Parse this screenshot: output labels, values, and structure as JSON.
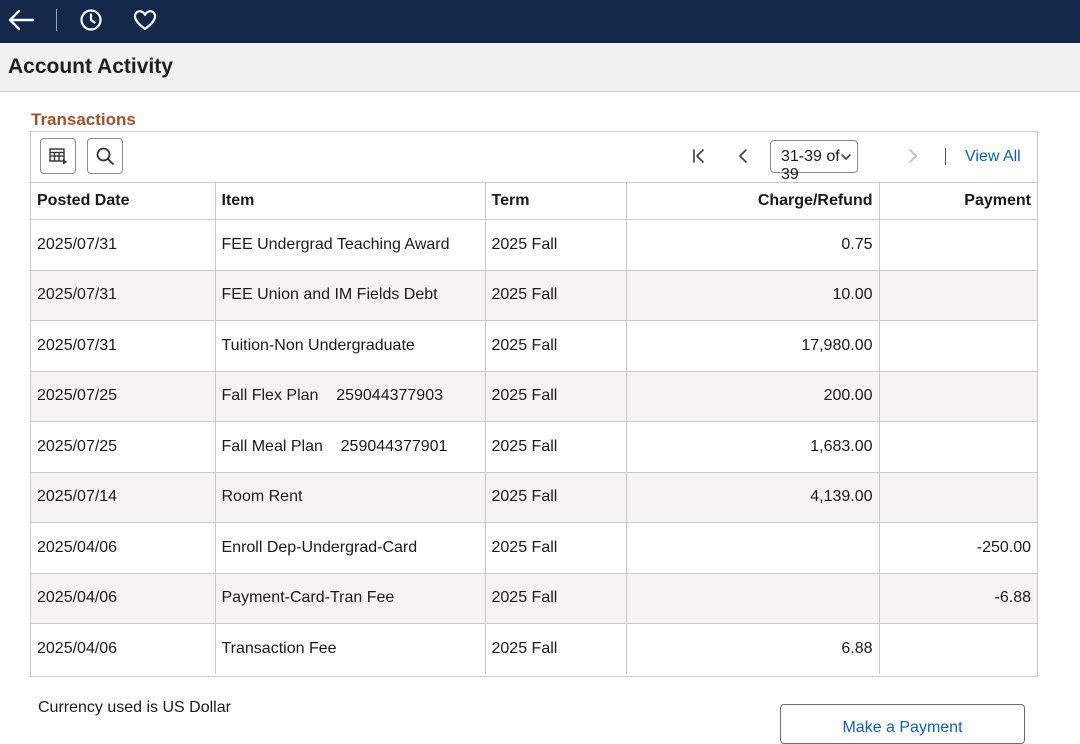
{
  "topbar": {
    "icons": [
      "back-arrow-icon",
      "history-icon",
      "favorite-heart-icon"
    ],
    "background": "#13284b"
  },
  "page": {
    "title": "Account Activity"
  },
  "transactions": {
    "section_title": "Transactions",
    "toolbar": {
      "grid_options_icon": "grid-options-icon",
      "search_icon": "search-icon"
    },
    "pager": {
      "range_label": "31-39 of 39",
      "view_all": "View All"
    },
    "columns": [
      "Posted Date",
      "Item",
      "Term",
      "Charge/Refund",
      "Payment"
    ],
    "rows": [
      {
        "posted_date": "2025/07/31",
        "item": "FEE Undergrad Teaching Award",
        "term": "2025 Fall",
        "charge_refund": "0.75",
        "payment": ""
      },
      {
        "posted_date": "2025/07/31",
        "item": "FEE Union and IM Fields Debt",
        "term": "2025 Fall",
        "charge_refund": "10.00",
        "payment": ""
      },
      {
        "posted_date": "2025/07/31",
        "item": "Tuition-Non Undergraduate",
        "term": "2025 Fall",
        "charge_refund": "17,980.00",
        "payment": ""
      },
      {
        "posted_date": "2025/07/25",
        "item": "Fall Flex Plan    259044377903",
        "term": "2025 Fall",
        "charge_refund": "200.00",
        "payment": ""
      },
      {
        "posted_date": "2025/07/25",
        "item": "Fall Meal Plan    259044377901",
        "term": "2025 Fall",
        "charge_refund": "1,683.00",
        "payment": ""
      },
      {
        "posted_date": "2025/07/14",
        "item": "Room Rent",
        "term": "2025 Fall",
        "charge_refund": "4,139.00",
        "payment": ""
      },
      {
        "posted_date": "2025/04/06",
        "item": "Enroll Dep-Undergrad-Card",
        "term": "2025 Fall",
        "charge_refund": "",
        "payment": "-250.00"
      },
      {
        "posted_date": "2025/04/06",
        "item": "Payment-Card-Tran Fee",
        "term": "2025 Fall",
        "charge_refund": "",
        "payment": "-6.88"
      },
      {
        "posted_date": "2025/04/06",
        "item": "Transaction Fee",
        "term": "2025 Fall",
        "charge_refund": "6.88",
        "payment": ""
      }
    ]
  },
  "footer": {
    "currency_note": "Currency used is US Dollar",
    "make_payment_label": "Make a Payment"
  },
  "colors": {
    "section_title": "#a0522d",
    "link": "#0b62b5",
    "row_alt": "#f5f4f2"
  }
}
